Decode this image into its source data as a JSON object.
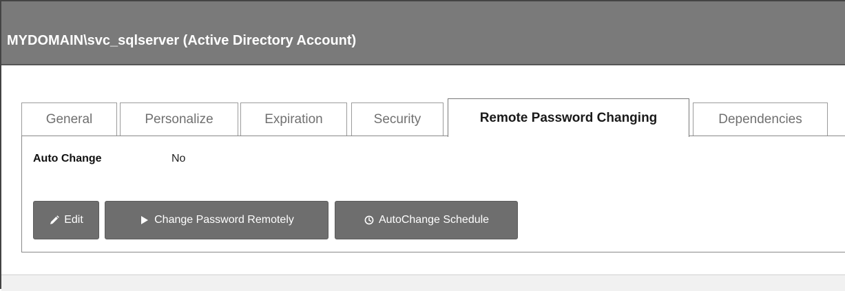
{
  "window": {
    "title": "MYDOMAIN\\svc_sqlserver (Active Directory Account)"
  },
  "tabs": [
    {
      "label": "General",
      "active": false
    },
    {
      "label": "Personalize",
      "active": false
    },
    {
      "label": "Expiration",
      "active": false
    },
    {
      "label": "Security",
      "active": false
    },
    {
      "label": "Remote Password Changing",
      "active": true
    },
    {
      "label": "Dependencies",
      "active": false
    }
  ],
  "panel": {
    "fields": [
      {
        "label": "Auto Change",
        "value": "No"
      }
    ],
    "buttons": [
      {
        "label": "Edit",
        "icon": "pencil-icon"
      },
      {
        "label": "Change Password Remotely",
        "icon": "play-icon"
      },
      {
        "label": "AutoChange Schedule",
        "icon": "clock-icon"
      }
    ]
  },
  "colors": {
    "titlebar_bg": "#7a7a7a",
    "button_bg": "#6e6e6e",
    "active_tab_text": "#1a1a1a",
    "inactive_tab_text": "#707070"
  }
}
